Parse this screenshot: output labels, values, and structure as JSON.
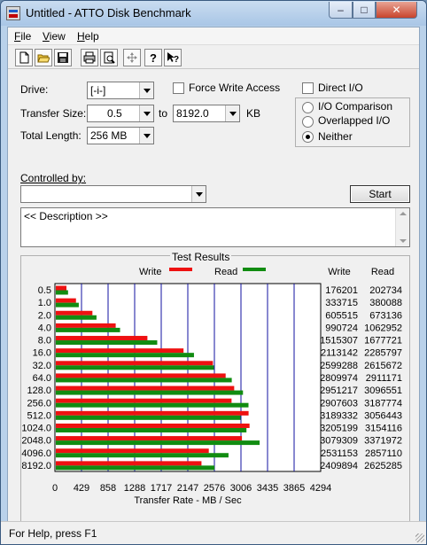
{
  "window": {
    "title": "Untitled - ATTO Disk Benchmark",
    "min_glyph": "–",
    "max_glyph": "□",
    "close_glyph": "✕"
  },
  "menu": [
    "File",
    "View",
    "Help"
  ],
  "toolbar": {
    "icons": [
      "new-file-icon",
      "open-folder-icon",
      "save-icon",
      "print-icon",
      "print-preview-icon",
      "move-icon",
      "help-question-icon",
      "context-help-icon"
    ]
  },
  "form": {
    "drive_label": "Drive:",
    "drive_value": "[-i-]",
    "force_write_label": "Force Write Access",
    "direct_io_label": "Direct I/O",
    "transfer_size_label": "Transfer Size:",
    "transfer_from": "0.5",
    "to_label": "to",
    "transfer_to": "8192.0",
    "kb_label": "KB",
    "total_length_label": "Total Length:",
    "total_length_value": "256 MB",
    "radio_io_comparison": "I/O Comparison",
    "radio_overlapped": "Overlapped I/O",
    "radio_neither": "Neither",
    "controlled_by_label": "Controlled by:",
    "controlled_by_value": "",
    "start_button": "Start",
    "description": "<< Description >>"
  },
  "results": {
    "section_title": "Test Results",
    "legend_write": "Write",
    "legend_read": "Read",
    "col_write": "Write",
    "col_read": "Read"
  },
  "status": {
    "text": "For Help, press F1"
  },
  "colors": {
    "write": "#ee1111",
    "read": "#118c11",
    "grid": "#1010a0"
  },
  "chart_data": {
    "type": "bar",
    "orientation": "horizontal",
    "title": "Test Results",
    "xlabel": "Transfer Rate - MB / Sec",
    "xlim": [
      0,
      4294
    ],
    "xticks": [
      "0",
      "429",
      "858",
      "1288",
      "1717",
      "2147",
      "2576",
      "3006",
      "3435",
      "3865",
      "4294"
    ],
    "categories": [
      "0.5",
      "1.0",
      "2.0",
      "4.0",
      "8.0",
      "16.0",
      "32.0",
      "64.0",
      "128.0",
      "256.0",
      "512.0",
      "1024.0",
      "2048.0",
      "4096.0",
      "8192.0"
    ],
    "series": [
      {
        "name": "Write",
        "values": [
          176201,
          333715,
          605515,
          990724,
          1515307,
          2113142,
          2599288,
          2809974,
          2951217,
          2907603,
          3189332,
          3205199,
          3079309,
          2531153,
          2409894
        ]
      },
      {
        "name": "Read",
        "values": [
          202734,
          380088,
          673136,
          1062952,
          1677721,
          2285797,
          2615672,
          2911171,
          3096551,
          3187774,
          3056443,
          3154116,
          3371972,
          2857110,
          2625285
        ]
      }
    ],
    "value_units_note_scale": 1024
  }
}
